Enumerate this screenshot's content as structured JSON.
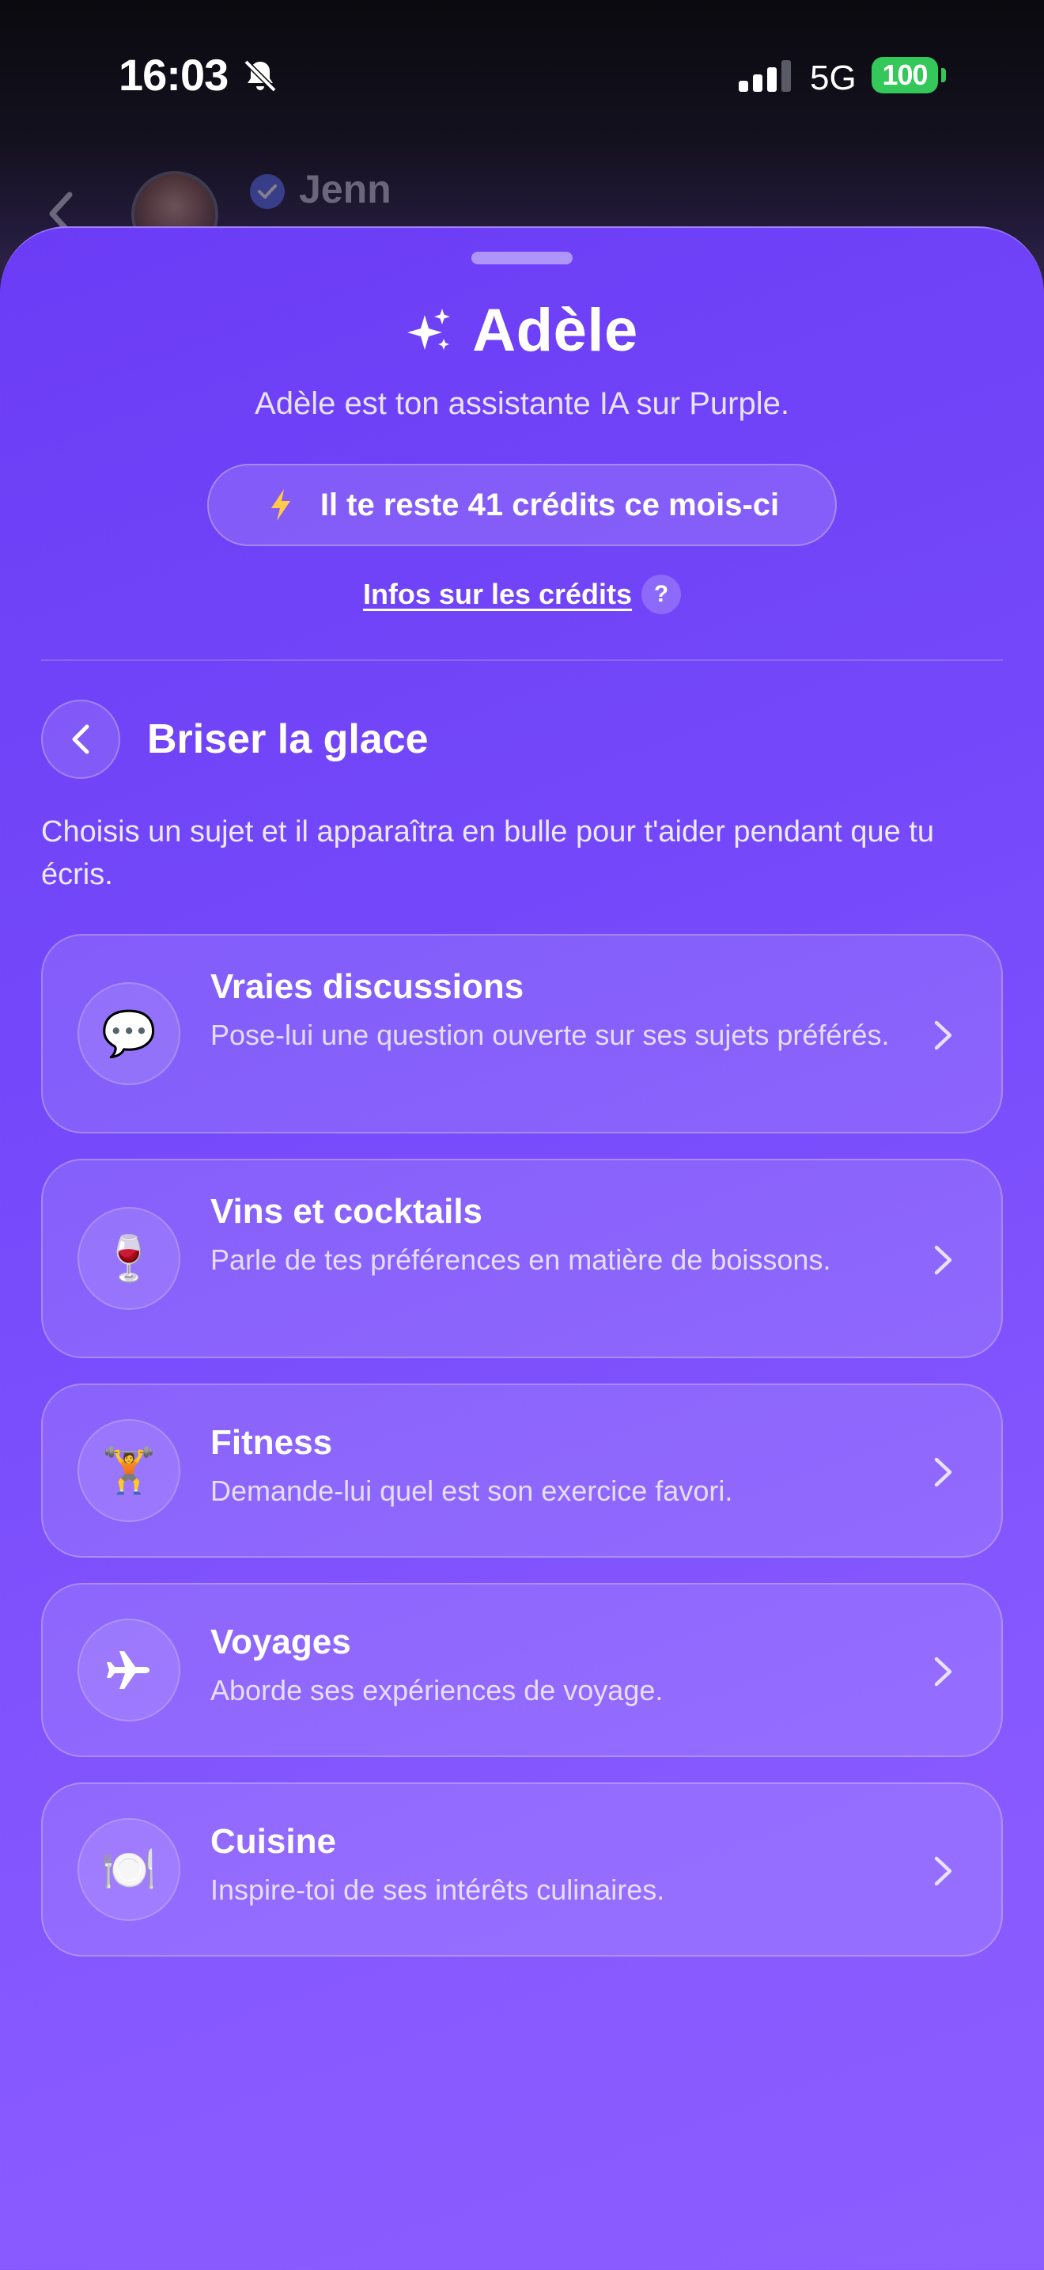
{
  "status_bar": {
    "time": "16:03",
    "network": "5G",
    "battery": "100"
  },
  "behind_header": {
    "name": "Jenn"
  },
  "sheet": {
    "title": "Adèle",
    "subtitle": "Adèle est ton assistante IA sur Purple.",
    "credits_text": "Il te reste 41 crédits ce mois-ci",
    "credits_info_link": "Infos sur les crédits",
    "help_glyph": "?"
  },
  "section": {
    "title": "Briser la glace",
    "description": "Choisis un sujet et il apparaîtra en bulle pour t'aider pendant que tu écris."
  },
  "topics": [
    {
      "title": "Vraies discussions",
      "description": "Pose-lui une question ouverte sur ses sujets préférés.",
      "emoji": "💬",
      "icon": "speech-bubble-icon"
    },
    {
      "title": "Vins et cocktails",
      "description": "Parle de tes préférences en matière de boissons.",
      "emoji": "🍷",
      "icon": "wine-glass-icon"
    },
    {
      "title": "Fitness",
      "description": "Demande-lui quel est son exercice favori.",
      "emoji": "🏋️",
      "icon": "weightlifter-icon"
    },
    {
      "title": "Voyages",
      "description": "Aborde ses expériences de voyage.",
      "emoji": "✈",
      "icon": "airplane-icon"
    },
    {
      "title": "Cuisine",
      "description": "Inspire-toi de ses intérêts culinaires.",
      "emoji": "🍽️",
      "icon": "plate-cutlery-icon"
    }
  ],
  "colors": {
    "sheet_top": "#6b3cf5",
    "sheet_bottom": "#8c5eff",
    "battery": "#34c759",
    "bolt": "#ffc94a"
  }
}
